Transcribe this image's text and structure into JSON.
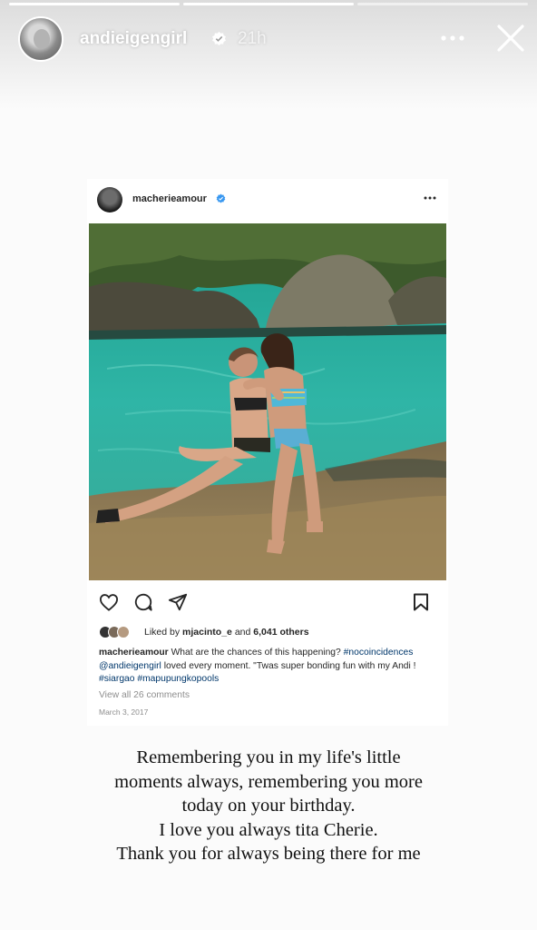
{
  "story": {
    "progress": [
      1.0,
      1.0,
      0.0
    ],
    "user": {
      "username": "andieigengirl",
      "verified": true,
      "time": "21h"
    },
    "icons": {
      "avatar": "profile-avatar",
      "verified": "verified-badge-icon",
      "more": "more-horizontal-icon",
      "close": "close-icon"
    },
    "text_lines": [
      "Remembering you in my life's little",
      "moments always, remembering you more",
      "today on your birthday.",
      "I love you always tita Cherie.",
      "Thank you for always being there for me"
    ]
  },
  "post": {
    "username": "macherieamour",
    "verified": true,
    "photo": "two-women-sitting-on-rocks-by-turquoise-tide-pool",
    "actions": [
      "heart-icon",
      "comment-icon",
      "share-icon",
      "bookmark-icon"
    ],
    "likes": {
      "prefix": "Liked by",
      "user": "mjacinto_e",
      "connector": "and",
      "others": "6,041 others"
    },
    "caption": {
      "user": "macherieamour",
      "text_1": "What are the chances of this happening?",
      "hashtag_1": "#nocoincidences",
      "mention": "@andieigengirl",
      "text_2": "loved every moment. \"Twas super bonding fun with my Andi !",
      "hashtag_2": "#siargao",
      "hashtag_3": "#mapupungkopools"
    },
    "view_comments": "View all 26 comments",
    "date": "March 3, 2017"
  },
  "colors": {
    "background": "#fbfbfb",
    "verified_blue": "#3897f0",
    "hashtag_blue": "#00376b",
    "muted_gray": "#8e8e8e",
    "water": "#2fb5a6"
  }
}
